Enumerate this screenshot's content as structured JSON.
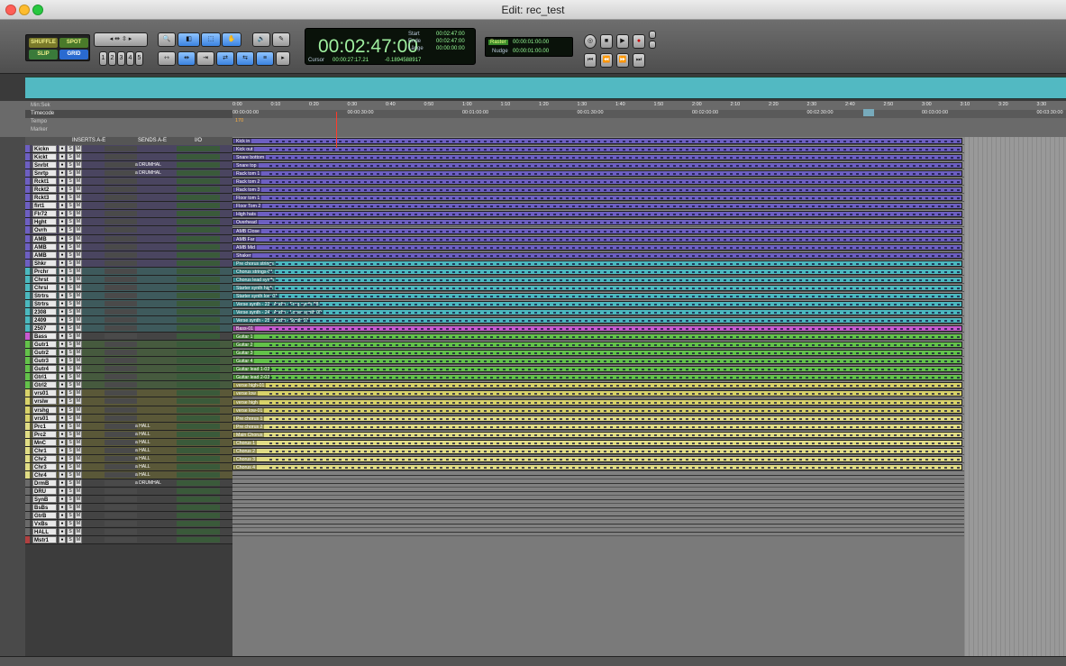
{
  "window": {
    "title": "Edit: rec_test"
  },
  "toolbar": {
    "modes": [
      "SHUFFLE",
      "SPOT",
      "SLIP",
      "GRID"
    ],
    "zoom_presets": [
      "1",
      "2",
      "3",
      "4",
      "5"
    ],
    "main_counter": "00:02:47:00",
    "start_label": "Start",
    "start_value": "00:02:47:00",
    "end_label": "Ende",
    "end_value": "00:02:47:00",
    "length_label": "Länge",
    "length_value": "00:00:00:00",
    "cursor_label": "Cursor",
    "cursor_value": "00:00:27:17.21",
    "cursor_level": "-0.1894588917",
    "grid_label": "Raster",
    "grid_value": "00:00:01:00.00",
    "nudge_label": "Nudge",
    "nudge_value": "00:00:01:00.00"
  },
  "rulers": {
    "minsec_label": "Min:Sek",
    "timecode_label": "Timecode",
    "tempo_label": "Tempo",
    "tempo_value": "170",
    "marker_label": "Marker",
    "minsec_ticks": [
      "0:00",
      "0:10",
      "0:20",
      "0:30",
      "0:40",
      "0:50",
      "1:00",
      "1:10",
      "1:20",
      "1:30",
      "1:40",
      "1:50",
      "2:00",
      "2:10",
      "2:20",
      "2:30",
      "2:40",
      "2:50",
      "3:00",
      "3:10",
      "3:20",
      "3:30"
    ],
    "timecode_ticks": [
      "00:00:00:00",
      "00:00:30:00",
      "00:01:00:00",
      "00:01:30:00",
      "00:02:00:00",
      "00:02:30:00",
      "00:03:00:00",
      "00:03:30:00"
    ]
  },
  "mix_header": {
    "inserts": "INSERTS A-E",
    "sends": "SENDS A-E",
    "io": "I/O"
  },
  "colors": {
    "drums": "#6d5fc2",
    "strings": "#4bb8bf",
    "bass": "#c85ad0",
    "guitar": "#63c24a",
    "vocals": "#d8d26a",
    "chorus": "#e0dc85",
    "aux": "#6a6a6a",
    "master": "#b04040"
  },
  "tracks": [
    {
      "name": "Kickn",
      "group": "drums",
      "send": "",
      "clip": "Kick in"
    },
    {
      "name": "Kickt",
      "group": "drums",
      "send": "",
      "clip": "Kick out"
    },
    {
      "name": "Snrbt",
      "group": "drums",
      "send": "a DRUMHAL",
      "clip": "Snare bottom"
    },
    {
      "name": "Snrtp",
      "group": "drums",
      "send": "a DRUMHAL",
      "clip": "Snare top"
    },
    {
      "name": "Rckt1",
      "group": "drums",
      "send": "",
      "clip": "Rack tom 1"
    },
    {
      "name": "Rckt2",
      "group": "drums",
      "send": "",
      "clip": "Rack tom 2"
    },
    {
      "name": "Rckt3",
      "group": "drums",
      "send": "",
      "clip": "Rack tom 3"
    },
    {
      "name": "flrt1",
      "group": "drums",
      "send": "",
      "clip": "Floor tom 1"
    },
    {
      "name": "Flr72",
      "group": "drums",
      "send": "",
      "clip": "Floor Tom 2"
    },
    {
      "name": "Hght",
      "group": "drums",
      "send": "",
      "clip": "High hats"
    },
    {
      "name": "Ovrh",
      "group": "drums",
      "send": "",
      "clip": "Overhead"
    },
    {
      "name": "AMB",
      "group": "drums",
      "send": "",
      "clip": "AMB Close"
    },
    {
      "name": "AMB",
      "group": "drums",
      "send": "",
      "clip": "AMB Far"
    },
    {
      "name": "AMB",
      "group": "drums",
      "send": "",
      "clip": "AMB Mid"
    },
    {
      "name": "Shkr",
      "group": "drums",
      "send": "",
      "clip": "Shaker"
    },
    {
      "name": "Prchr",
      "group": "strings",
      "send": "",
      "clip": "Pre chorus strings"
    },
    {
      "name": "Chrst",
      "group": "strings",
      "send": "",
      "clip": "Chorus strings-01"
    },
    {
      "name": "Chrsl",
      "group": "strings",
      "send": "",
      "clip": "Chorus lead synth"
    },
    {
      "name": "Strtrs",
      "group": "strings",
      "send": "",
      "clip": "Starter synth high"
    },
    {
      "name": "Strtrs",
      "group": "strings",
      "send": "",
      "clip": "Starter synth low-01"
    },
    {
      "name": "2308",
      "group": "strings",
      "send": "",
      "clip": "Verse synth - 23 - Audio - Freq synth 08"
    },
    {
      "name": "2409",
      "group": "strings",
      "send": "",
      "clip": "Verse synth - 24 - Audio - Lower synth 09"
    },
    {
      "name": "2507",
      "group": "strings",
      "send": "",
      "clip": "Verse synth - 25 - Audio - Synth 07"
    },
    {
      "name": "Bass",
      "group": "bass",
      "send": "",
      "clip": "Bass-01"
    },
    {
      "name": "Gutr1",
      "group": "guitar",
      "send": "",
      "clip": "Guitar 1"
    },
    {
      "name": "Gutr2",
      "group": "guitar",
      "send": "",
      "clip": "Guitar 2"
    },
    {
      "name": "Gutr3",
      "group": "guitar",
      "send": "",
      "clip": "Guitar 3"
    },
    {
      "name": "Gutr4",
      "group": "guitar",
      "send": "",
      "clip": "Guitar 4"
    },
    {
      "name": "Gtrl1",
      "group": "guitar",
      "send": "",
      "clip": "Guitar lead 1-03"
    },
    {
      "name": "Gtrl2",
      "group": "guitar",
      "send": "",
      "clip": "Guitar lead 2-03"
    },
    {
      "name": "vrs01",
      "group": "vocals",
      "send": "",
      "clip": "verse high-01"
    },
    {
      "name": "vrslw",
      "group": "vocals",
      "send": "",
      "clip": "verse low"
    },
    {
      "name": "vrshg",
      "group": "vocals",
      "send": "",
      "clip": "verse high"
    },
    {
      "name": "vrs01",
      "group": "vocals",
      "send": "",
      "clip": "verse low-01"
    },
    {
      "name": "Prc1",
      "group": "chorus",
      "send": "a HALL",
      "clip": "Pre chorus 1"
    },
    {
      "name": "Prc2",
      "group": "chorus",
      "send": "a HALL",
      "clip": "Pre chorus 2"
    },
    {
      "name": "MnC",
      "group": "chorus",
      "send": "a HALL",
      "clip": "Main Chorus"
    },
    {
      "name": "Chr1",
      "group": "chorus",
      "send": "a HALL",
      "clip": "Chorus 1"
    },
    {
      "name": "Chr2",
      "group": "chorus",
      "send": "a HALL",
      "clip": "Chorus 2"
    },
    {
      "name": "Chr3",
      "group": "chorus",
      "send": "a HALL",
      "clip": "Chorus 3"
    },
    {
      "name": "Chr4",
      "group": "chorus",
      "send": "a HALL",
      "clip": "Chorus 4"
    },
    {
      "name": "DrmB",
      "group": "aux",
      "send": "a DRUMHAL",
      "clip": ""
    },
    {
      "name": "DRU",
      "group": "aux",
      "send": "",
      "clip": ""
    },
    {
      "name": "SynB",
      "group": "aux",
      "send": "",
      "clip": ""
    },
    {
      "name": "BsBs",
      "group": "aux",
      "send": "",
      "clip": ""
    },
    {
      "name": "GtrB",
      "group": "aux",
      "send": "",
      "clip": ""
    },
    {
      "name": "VxBs",
      "group": "aux",
      "send": "",
      "clip": ""
    },
    {
      "name": "HALL",
      "group": "aux",
      "send": "",
      "clip": ""
    },
    {
      "name": "Mstr1",
      "group": "master",
      "send": "",
      "clip": ""
    }
  ]
}
